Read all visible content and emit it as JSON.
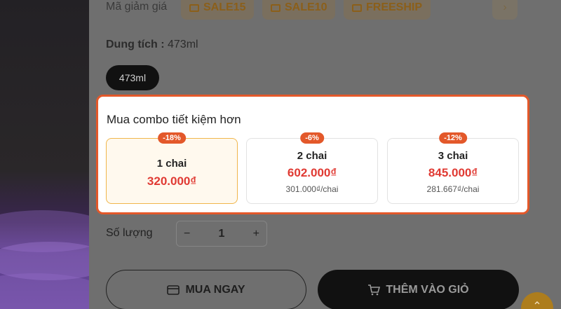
{
  "coupons": {
    "label": "Mã giảm giá",
    "items": [
      "SALE15",
      "SALE10",
      "FREESHIP"
    ],
    "next_icon": "chevron-right-icon"
  },
  "capacity": {
    "label": "Dung tích :",
    "value": "473ml",
    "options": [
      "473ml"
    ]
  },
  "combo": {
    "title": "Mua combo tiết kiệm hơn",
    "options": [
      {
        "badge": "-18%",
        "qty": "1 chai",
        "price": "320.000₫",
        "unit_price": "",
        "selected": true
      },
      {
        "badge": "-6%",
        "qty": "2 chai",
        "price": "602.000₫",
        "unit_price": "301.000₫/chai",
        "selected": false
      },
      {
        "badge": "-12%",
        "qty": "3 chai",
        "price": "845.000₫",
        "unit_price": "281.667₫/chai",
        "selected": false
      }
    ]
  },
  "quantity": {
    "label": "Số lượng",
    "value": "1",
    "decrement": "−",
    "increment": "+"
  },
  "actions": {
    "buy_now": "MUA NGAY",
    "add_to_cart": "THÊM VÀO GIỎ"
  },
  "colors": {
    "accent": "#e3582a",
    "price": "#e03a33",
    "selected_bg": "#fff9ee"
  }
}
